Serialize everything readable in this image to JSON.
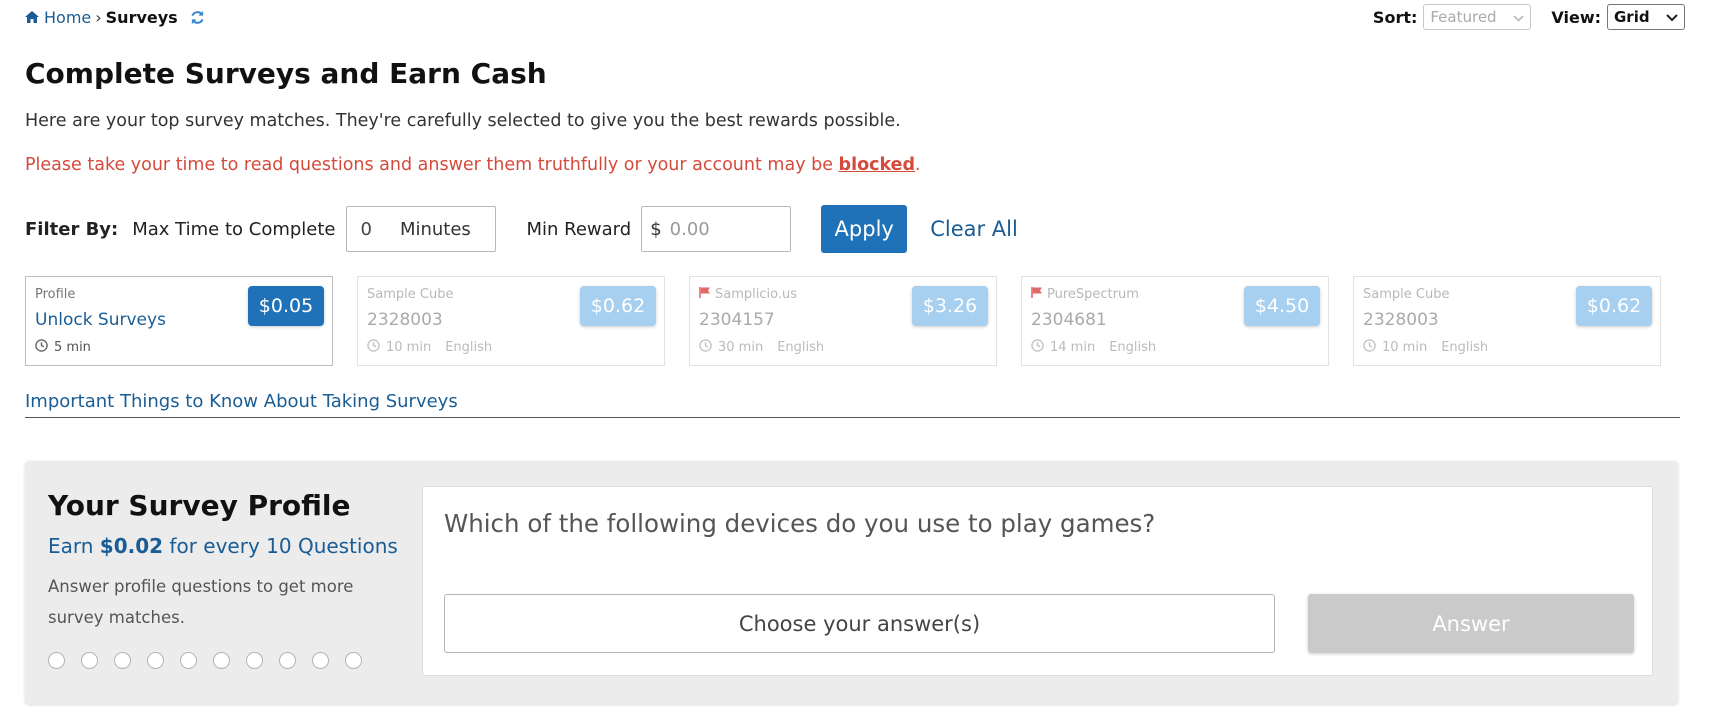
{
  "breadcrumb": {
    "home": "Home",
    "separator": "›",
    "current": "Surveys"
  },
  "sort": {
    "label": "Sort:",
    "value": "Featured"
  },
  "view": {
    "label": "View:",
    "value": "Grid"
  },
  "page_title": "Complete Surveys and Earn Cash",
  "intro": "Here are your top survey matches. They're carefully selected to give you the best rewards possible.",
  "warning": {
    "text": "Please take your time to read questions and answer them truthfully or your account may be ",
    "emphasis": "blocked",
    "end": "."
  },
  "filter": {
    "label": "Filter By:",
    "max_time_label": "Max Time to Complete",
    "max_time_value": "0",
    "max_time_unit": "Minutes",
    "min_reward_label": "Min Reward",
    "currency": "$",
    "min_reward_placeholder": "0.00",
    "apply": "Apply",
    "clear_all": "Clear All"
  },
  "cards": [
    {
      "provider": "Profile",
      "title": "Unlock Surveys",
      "time": "5 min",
      "language": "",
      "price": "$0.05",
      "flag": false,
      "active": true
    },
    {
      "provider": "Sample Cube",
      "title": "2328003",
      "time": "10 min",
      "language": "English",
      "price": "$0.62",
      "flag": false,
      "active": false
    },
    {
      "provider": "Samplicio.us",
      "title": "2304157",
      "time": "30 min",
      "language": "English",
      "price": "$3.26",
      "flag": true,
      "active": false
    },
    {
      "provider": "PureSpectrum",
      "title": "2304681",
      "time": "14 min",
      "language": "English",
      "price": "$4.50",
      "flag": true,
      "active": false
    },
    {
      "provider": "Sample Cube",
      "title": "2328003",
      "time": "10 min",
      "language": "English",
      "price": "$0.62",
      "flag": false,
      "active": false
    }
  ],
  "important_link": "Important Things to Know About Taking Surveys",
  "profile": {
    "title": "Your Survey Profile",
    "earn_prefix": "Earn ",
    "earn_amount": "$0.02",
    "earn_suffix": " for every 10 Questions",
    "description": "Answer profile questions to get more survey matches.",
    "progress_total": 10,
    "progress_done": 0
  },
  "question": {
    "text": "Which of the following devices do you use to play games?",
    "select_placeholder": "Choose your answer(s)",
    "answer_button": "Answer"
  },
  "colors": {
    "accent": "#1f72b8",
    "link": "#1a5d95",
    "warning": "#d64a3b",
    "price_light": "#a6cff0",
    "flag": "#e06a6a"
  }
}
